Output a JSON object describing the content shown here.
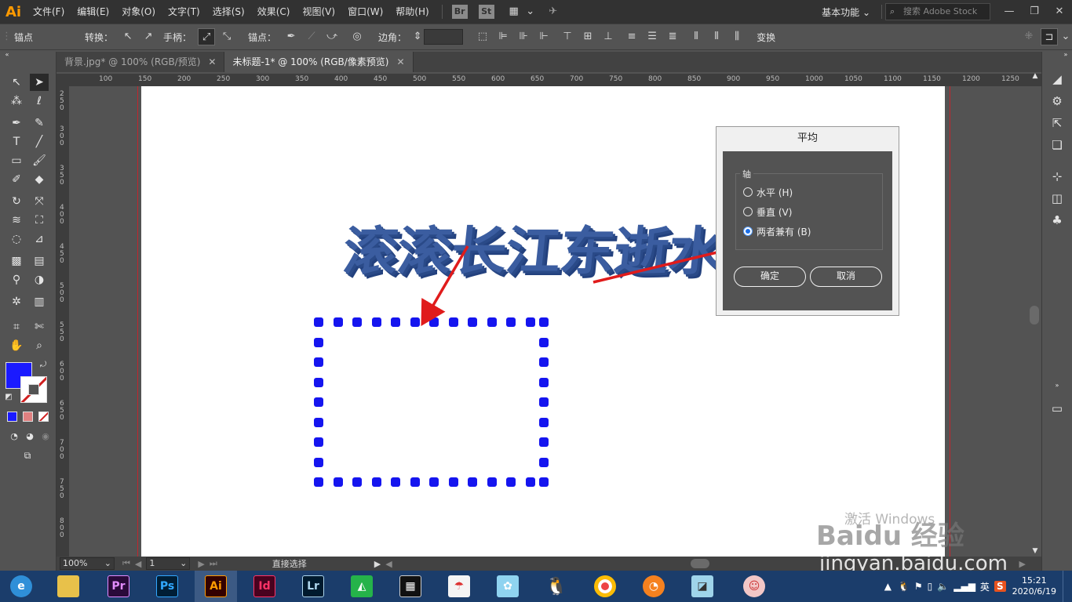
{
  "app": {
    "logo": "Ai"
  },
  "menubar": {
    "items": [
      "文件(F)",
      "编辑(E)",
      "对象(O)",
      "文字(T)",
      "选择(S)",
      "效果(C)",
      "视图(V)",
      "窗口(W)",
      "帮助(H)"
    ],
    "bridge": "Br",
    "stock": "St",
    "workspace": "基本功能",
    "search_placeholder": "搜索 Adobe Stock"
  },
  "controlbar": {
    "anchor_label": "锚点",
    "convert_label": "转换：",
    "handles_label": "手柄：",
    "anchors_label": "锚点：",
    "corner_label": "边角：",
    "transform_label": "变换"
  },
  "tabs": [
    {
      "label": "背景.jpg* @ 100% (RGB/预览)",
      "active": false
    },
    {
      "label": "未标题-1* @ 100% (RGB/像素预览)",
      "active": true
    }
  ],
  "rulers": {
    "top": [
      "100",
      "150",
      "200",
      "250",
      "300",
      "350",
      "400",
      "450",
      "500",
      "550",
      "600",
      "650",
      "700",
      "750",
      "800",
      "850",
      "900",
      "950",
      "1000",
      "1050",
      "1100",
      "1150",
      "1200",
      "1250"
    ],
    "left": [
      "2\n5\n0",
      "3\n0\n0",
      "3\n5\n0",
      "4\n0\n0",
      "4\n5\n0",
      "5\n0\n0",
      "5\n5\n0",
      "6\n0\n0",
      "6\n5\n0",
      "7\n0\n0",
      "7\n5\n0",
      "8\n0\n0"
    ]
  },
  "canvas": {
    "headline": "滚滚长江东逝水",
    "headline_color": "#3b5da0",
    "dot_color": "#1515ef"
  },
  "dialog": {
    "title": "平均",
    "group_label": "轴",
    "options": [
      {
        "label": "水平 (H)",
        "checked": false
      },
      {
        "label": "垂直 (V)",
        "checked": false
      },
      {
        "label": "两者兼有 (B)",
        "checked": true
      }
    ],
    "ok": "确定",
    "cancel": "取消"
  },
  "statusbar": {
    "zoom": "100%",
    "artboard_number": "1",
    "tool": "直接选择"
  },
  "watermark": {
    "activate": "激活 Windows",
    "brand": "Baidu 经验",
    "url": "jingyan.baidu.com"
  },
  "taskbar": {
    "apps": [
      {
        "name": "Pr",
        "color": "#e38cff",
        "bg": "#2a0a3a"
      },
      {
        "name": "Ps",
        "color": "#31a8ff",
        "bg": "#001e36"
      },
      {
        "name": "Ai",
        "color": "#ff9a00",
        "bg": "#330000"
      },
      {
        "name": "Id",
        "color": "#ff3366",
        "bg": "#49021f"
      },
      {
        "name": "Lr",
        "color": "#add5ec",
        "bg": "#001a2e"
      }
    ],
    "ime": "英",
    "time": "15:21",
    "date": "2020/6/19"
  }
}
